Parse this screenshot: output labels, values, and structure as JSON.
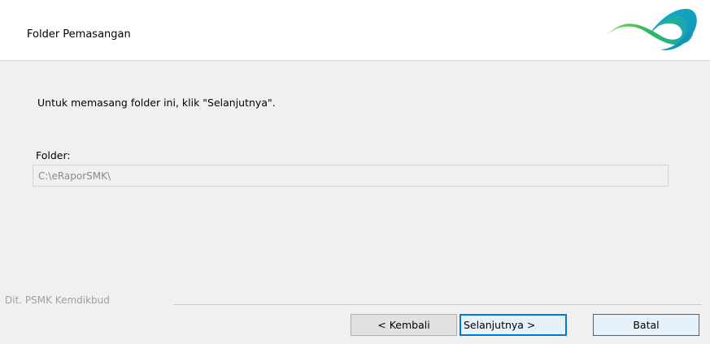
{
  "header": {
    "title": "Folder Pemasangan",
    "logo_icon": "infinity-logo-icon",
    "logo_colors": [
      "#17a2c6",
      "#2dbd5a",
      "#7ed957"
    ]
  },
  "main": {
    "instruction": "Untuk memasang folder ini, klik \"Selanjutnya\".",
    "folder_label": "Folder:",
    "folder_value": "C:\\eRaporSMK\\"
  },
  "footer": {
    "brand": "Dit. PSMK Kemdikbud",
    "back_label": "< Kembali",
    "next_label": "Selanjutnya >",
    "cancel_label": "Batal"
  },
  "colors": {
    "accent": "#0078d7",
    "background": "#f0f0f0",
    "header_background": "#ffffff"
  }
}
